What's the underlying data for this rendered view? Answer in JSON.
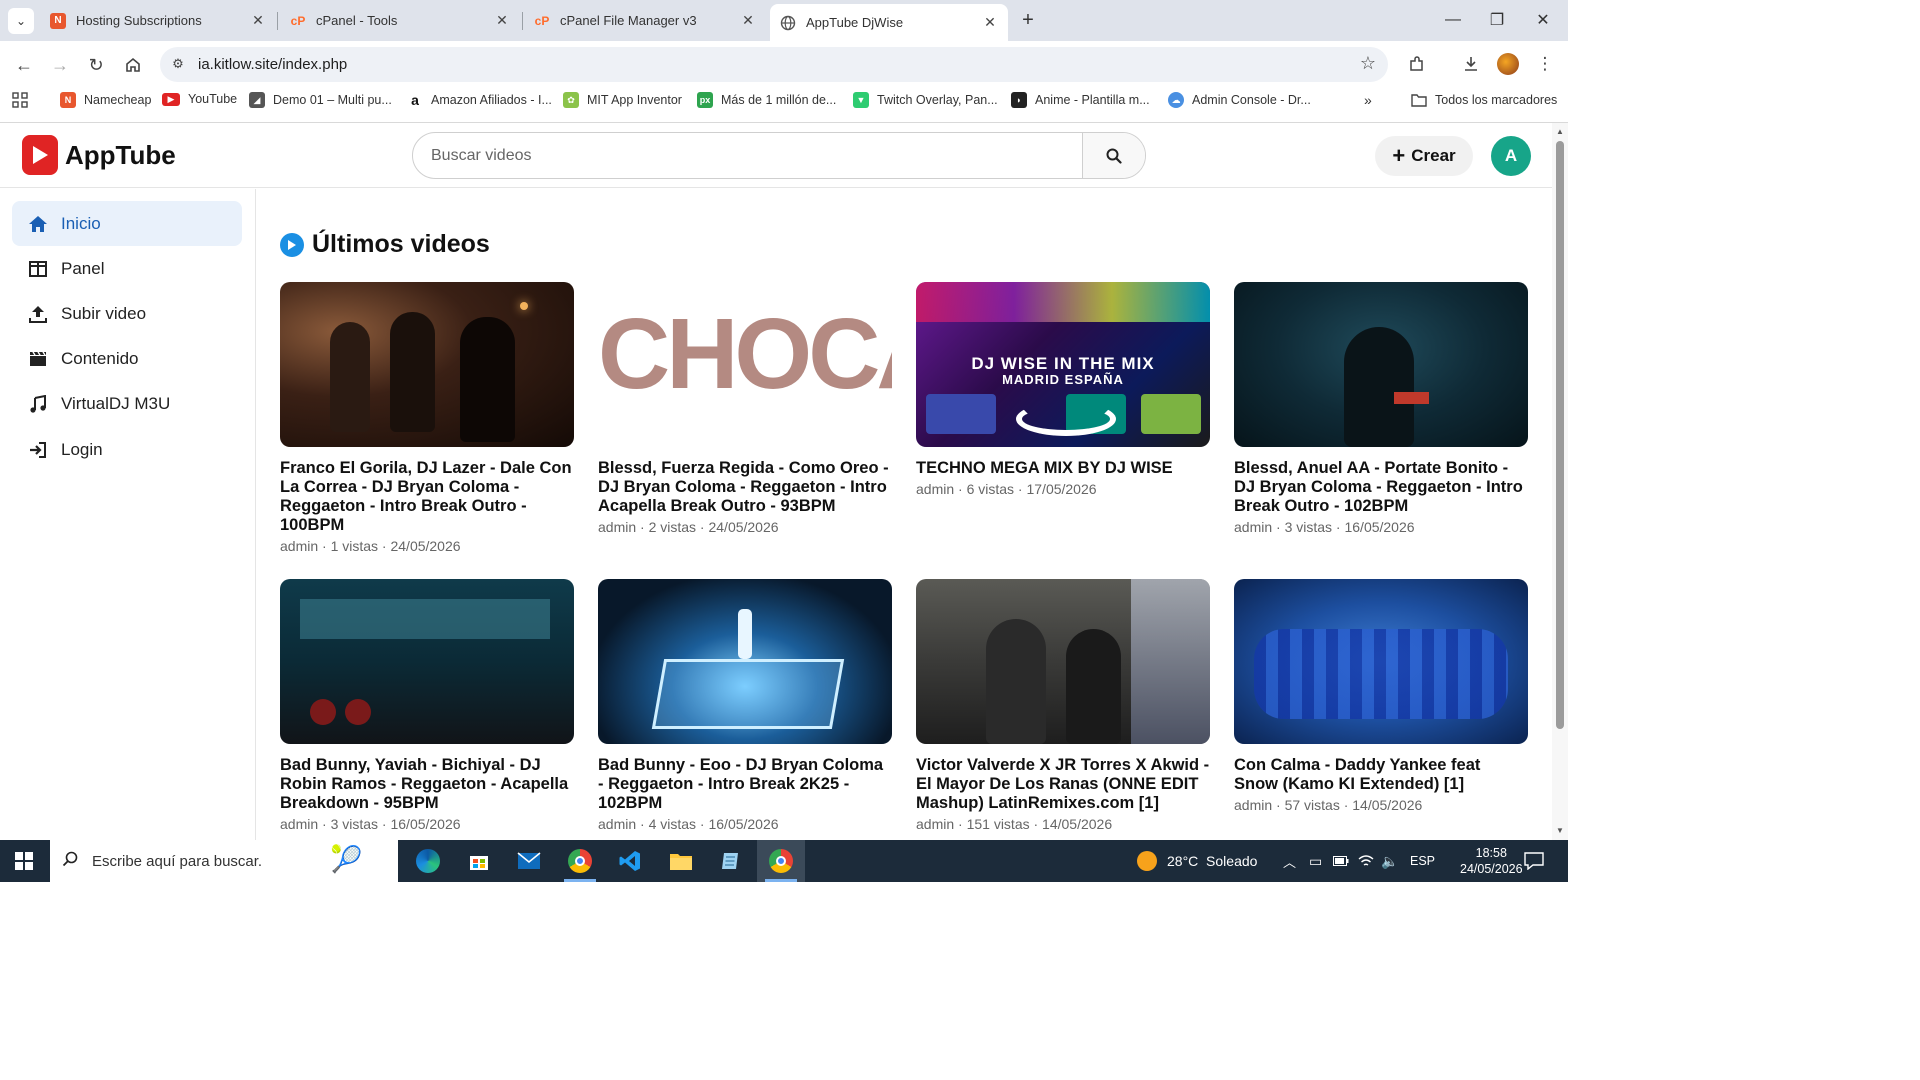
{
  "browser": {
    "tabs": [
      {
        "title": "Hosting Subscriptions",
        "favicon": "namecheap-icon",
        "active": false
      },
      {
        "title": "cPanel - Tools",
        "favicon": "cpanel-icon",
        "active": false
      },
      {
        "title": "cPanel File Manager v3",
        "favicon": "cpanel-icon",
        "active": false
      },
      {
        "title": "AppTube DjWise",
        "favicon": "globe-icon",
        "active": true
      }
    ],
    "url": "ia.kitlow.site/index.php",
    "bookmarks": [
      "Namecheap",
      "YouTube",
      "Demo 01 – Multi pu...",
      "Amazon Afiliados - I...",
      "MIT App Inventor",
      "Más de 1 millón de...",
      "Twitch Overlay, Pan...",
      "Anime - Plantilla m...",
      "Admin Console - Dr..."
    ],
    "all_bookmarks": "Todos los marcadores"
  },
  "app": {
    "name": "AppTube",
    "search_placeholder": "Buscar videos",
    "create_label": "Crear",
    "avatar_initial": "A",
    "colors": {
      "brand": "#e02424",
      "accent": "#1a8fe3",
      "active_nav_bg": "#e9f1fb",
      "avatar": "#17a589"
    }
  },
  "sidebar": {
    "items": [
      {
        "label": "Inicio",
        "icon": "home-icon",
        "active": true
      },
      {
        "label": "Panel",
        "icon": "panel-icon",
        "active": false
      },
      {
        "label": "Subir video",
        "icon": "upload-icon",
        "active": false
      },
      {
        "label": "Contenido",
        "icon": "clapperboard-icon",
        "active": false
      },
      {
        "label": "VirtualDJ M3U",
        "icon": "music-note-icon",
        "active": false
      },
      {
        "label": "Login",
        "icon": "login-icon",
        "active": false
      }
    ]
  },
  "main": {
    "section_title": "Últimos videos",
    "videos": [
      {
        "title": "Franco El Gorila, DJ Lazer - Dale Con La Correa - DJ Bryan Coloma - Reggaeton - Intro Break Outro - 100BPM",
        "meta": "admin · 1 vistas · 24/05/2026"
      },
      {
        "title": "Blessd, Fuerza Regida - Como Oreo - DJ Bryan Coloma - Reggaeton - Intro Acapella Break Outro - 93BPM",
        "meta": "admin · 2 vistas · 24/05/2026",
        "thumb_text": "CHOCA"
      },
      {
        "title": "TECHNO MEGA MIX BY DJ WISE",
        "meta": "admin · 6 vistas · 17/05/2026",
        "thumb_text": "DJ WISE IN THE MIX",
        "thumb_subtext": "MADRID ESPAÑA"
      },
      {
        "title": "Blessd, Anuel AA - Portate Bonito - DJ Bryan Coloma - Reggaeton - Intro Break Outro - 102BPM",
        "meta": "admin · 3 vistas · 16/05/2026"
      },
      {
        "title": "Bad Bunny, Yaviah - Bichiyal - DJ Robin Ramos - Reggaeton - Acapella Breakdown - 95BPM",
        "meta": "admin · 3 vistas · 16/05/2026"
      },
      {
        "title": "Bad Bunny - Eoo - DJ Bryan Coloma - Reggaeton - Intro Break 2K25 - 102BPM",
        "meta": "admin · 4 vistas · 16/05/2026"
      },
      {
        "title": "Victor Valverde X JR Torres X Akwid - El Mayor De Los Ranas (ONNE EDIT Mashup) LatinRemixes.com [1]",
        "meta": "admin · 151 vistas · 14/05/2026"
      },
      {
        "title": "Con Calma - Daddy Yankee feat Snow (Kamo KI Extended) [1]",
        "meta": "admin · 57 vistas · 14/05/2026"
      }
    ]
  },
  "taskbar": {
    "search_placeholder": "Escribe aquí para buscar.",
    "weather": "28°C  Soleado",
    "language": "ESP",
    "time": "18:58",
    "date": "24/05/2026"
  }
}
